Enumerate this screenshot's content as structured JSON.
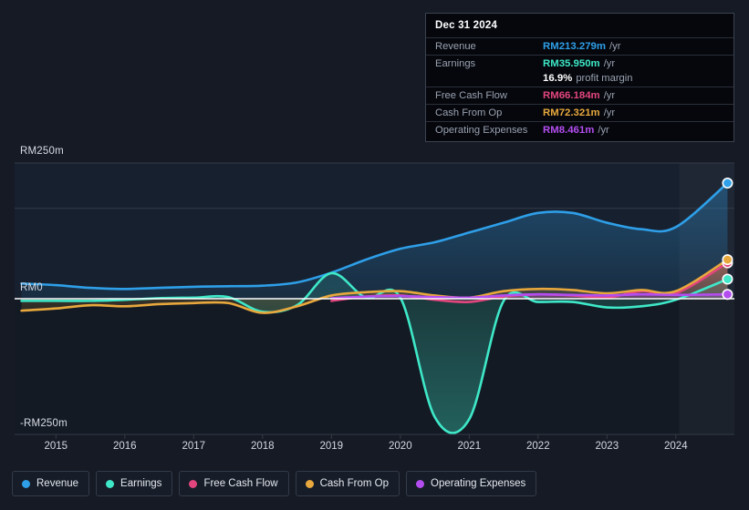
{
  "chart_data": {
    "type": "area",
    "title": "",
    "xlabel": "",
    "ylabel": "",
    "currency_prefix": "RM",
    "unit_suffix": "m",
    "grid": true,
    "legend_position": "bottom",
    "x": [
      2014.5,
      2015,
      2015.5,
      2016,
      2016.5,
      2017,
      2017.5,
      2018,
      2018.5,
      2019,
      2019.5,
      2020,
      2020.5,
      2021,
      2021.5,
      2022,
      2022.5,
      2023,
      2023.5,
      2024,
      2024.75
    ],
    "xticks": [
      "2015",
      "2016",
      "2017",
      "2018",
      "2019",
      "2020",
      "2021",
      "2022",
      "2023",
      "2024"
    ],
    "yticks": [
      "RM250m",
      "RM0",
      "-RM250m"
    ],
    "ylim": [
      -250,
      250
    ],
    "xlim": [
      2014.4,
      2024.85
    ],
    "series": [
      {
        "name": "Revenue",
        "color": "#2e9fe8",
        "values": [
          28,
          25,
          20,
          18,
          20,
          22,
          23,
          24,
          30,
          48,
          72,
          92,
          104,
          122,
          140,
          158,
          158,
          140,
          128,
          132,
          213
        ]
      },
      {
        "name": "Earnings",
        "color": "#3ee8c8",
        "values": [
          -4,
          -4,
          -4,
          -2,
          1,
          2,
          3,
          -24,
          -12,
          47,
          2,
          2,
          -218,
          -222,
          -4,
          -6,
          -6,
          -16,
          -14,
          -2,
          36
        ]
      },
      {
        "name": "Free Cash Flow",
        "color": "#e3457e",
        "values": [
          null,
          null,
          null,
          null,
          null,
          null,
          null,
          null,
          null,
          -4,
          4,
          6,
          -2,
          -6,
          4,
          8,
          6,
          2,
          14,
          10,
          66
        ]
      },
      {
        "name": "Cash From Op",
        "color": "#e8a83d",
        "values": [
          -22,
          -18,
          -12,
          -14,
          -10,
          -8,
          -8,
          -26,
          -14,
          6,
          12,
          14,
          6,
          2,
          14,
          18,
          16,
          10,
          16,
          14,
          72
        ]
      },
      {
        "name": "Operating Expenses",
        "color": "#b44df0",
        "values": [
          null,
          null,
          null,
          null,
          null,
          null,
          null,
          null,
          null,
          1,
          4,
          5,
          3,
          2,
          6,
          8,
          7,
          6,
          8,
          7,
          8
        ]
      }
    ],
    "forecast_band_start_year": 2024.05
  },
  "tooltip": {
    "title": "Dec 31 2024",
    "rows": [
      {
        "label": "Revenue",
        "value": "RM213.279m",
        "unit": "/yr",
        "color": "#2e9fe8"
      },
      {
        "label": "Earnings",
        "value": "RM35.950m",
        "unit": "/yr",
        "color": "#3ee8c8"
      },
      {
        "label": "",
        "value": "16.9%",
        "unit": "profit margin",
        "color": "#ffffff",
        "sub": true
      },
      {
        "label": "Free Cash Flow",
        "value": "RM66.184m",
        "unit": "/yr",
        "color": "#e3457e"
      },
      {
        "label": "Cash From Op",
        "value": "RM72.321m",
        "unit": "/yr",
        "color": "#e8a83d"
      },
      {
        "label": "Operating Expenses",
        "value": "RM8.461m",
        "unit": "/yr",
        "color": "#b44df0"
      }
    ]
  },
  "legend": {
    "items": [
      {
        "label": "Revenue",
        "color": "#2e9fe8"
      },
      {
        "label": "Earnings",
        "color": "#3ee8c8"
      },
      {
        "label": "Free Cash Flow",
        "color": "#e3457e"
      },
      {
        "label": "Cash From Op",
        "color": "#e8a83d"
      },
      {
        "label": "Operating Expenses",
        "color": "#b44df0"
      }
    ]
  },
  "axis": {
    "y_top_label": "RM250m",
    "y_zero_label": "RM0",
    "y_bottom_label": "-RM250m"
  }
}
